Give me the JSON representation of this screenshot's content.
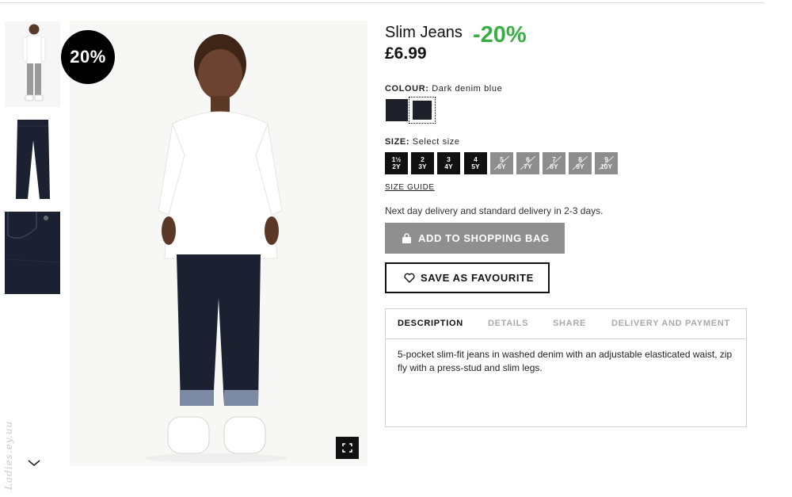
{
  "product": {
    "title": "Slim Jeans",
    "discount": "-20%",
    "price": "£6.99",
    "badge": "20%"
  },
  "colour": {
    "label": "COLOUR:",
    "value": "Dark denim blue",
    "swatches": [
      "#1d2028",
      "#1d2028"
    ]
  },
  "size": {
    "label": "SIZE:",
    "value": "Select size",
    "options": [
      {
        "top": "1½",
        "bottom": "2Y",
        "available": true
      },
      {
        "top": "2",
        "bottom": "3Y",
        "available": true
      },
      {
        "top": "3",
        "bottom": "4Y",
        "available": true
      },
      {
        "top": "4",
        "bottom": "5Y",
        "available": true
      },
      {
        "top": "5",
        "bottom": "6Y",
        "available": false
      },
      {
        "top": "6",
        "bottom": "7Y",
        "available": false
      },
      {
        "top": "7",
        "bottom": "8Y",
        "available": false
      },
      {
        "top": "8",
        "bottom": "9Y",
        "available": false
      },
      {
        "top": "9",
        "bottom": "10Y",
        "available": false
      }
    ],
    "guide": "SIZE GUIDE"
  },
  "delivery": "Next day delivery and standard delivery in 2-3 days.",
  "actions": {
    "add_to_bag": "ADD TO SHOPPING BAG",
    "save_favourite": "SAVE AS FAVOURITE"
  },
  "tabs": [
    "DESCRIPTION",
    "DETAILS",
    "SHARE",
    "DELIVERY AND PAYMENT"
  ],
  "description": "5-pocket slim-fit jeans in washed denim with an adjustable elasticated waist, zip fly with a press-stud and slim legs.",
  "watermark": "Ladies.ey.uu",
  "colors": {
    "discount_green": "#3aad43",
    "button_grey": "#8f8f8f",
    "denim": "#1d2028"
  },
  "icons": [
    "chevron-down-icon",
    "fullscreen-icon",
    "bag-icon",
    "heart-icon"
  ]
}
